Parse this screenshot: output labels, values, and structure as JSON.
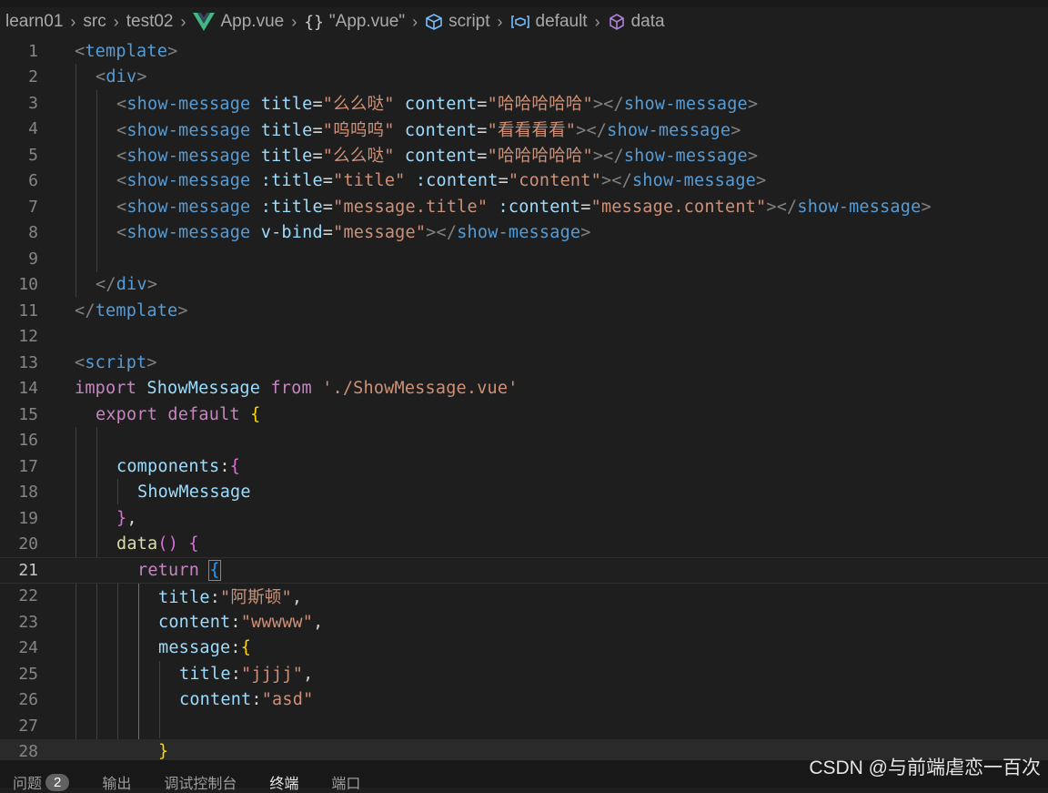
{
  "breadcrumb": {
    "items": [
      "learn01",
      "src",
      "test02",
      "App.vue",
      "\"App.vue\"",
      "script",
      "default",
      "data"
    ],
    "icons": [
      "vue-logo-icon",
      "braces-icon",
      "script-icon",
      "variable-icon",
      "cube-icon"
    ]
  },
  "editor": {
    "current_line": 21,
    "line_numbers": [
      "1",
      "2",
      "3",
      "4",
      "5",
      "6",
      "7",
      "8",
      "9",
      "10",
      "11",
      "12",
      "13",
      "14",
      "15",
      "16",
      "17",
      "18",
      "19",
      "20",
      "21",
      "22",
      "23",
      "24",
      "25",
      "26",
      "27",
      "28"
    ],
    "lines": {
      "l1": {
        "open": "<",
        "tag": "template",
        "close": ">"
      },
      "l2": {
        "open": "<",
        "tag": "div",
        "close": ">"
      },
      "l3": {
        "comp": "show-message",
        "a1": "title",
        "v1": "\"么么哒\"",
        "a2": "content",
        "v2": "\"哈哈哈哈哈\"",
        "end": "show-message"
      },
      "l4": {
        "comp": "show-message",
        "a1": "title",
        "v1": "\"呜呜呜\"",
        "a2": "content",
        "v2": "\"看看看看\"",
        "end": "show-message"
      },
      "l5": {
        "comp": "show-message",
        "a1": "title",
        "v1": "\"么么哒\"",
        "a2": "content",
        "v2": "\"哈哈哈哈哈\"",
        "end": "show-message"
      },
      "l6": {
        "comp": "show-message",
        "a1": ":title",
        "v1": "\"title\"",
        "a2": ":content",
        "v2": "\"content\"",
        "end": "show-message"
      },
      "l7": {
        "comp": "show-message",
        "a1": ":title",
        "v1": "\"message.title\"",
        "a2": ":content",
        "v2": "\"message.content\"",
        "end": "show-message"
      },
      "l8": {
        "comp": "show-message",
        "a1": "v-bind",
        "v1": "\"message\"",
        "end": "show-message"
      },
      "l10": {
        "tag": "div"
      },
      "l11": {
        "tag": "template"
      },
      "l13": {
        "tag": "script"
      },
      "l14": {
        "kw1": "import",
        "cls": "ShowMessage",
        "kw2": "from",
        "str": "'./ShowMessage.vue'"
      },
      "l15": {
        "kw1": "export",
        "kw2": "default",
        "brace": "{"
      },
      "l17": {
        "prop": "components",
        "brace": "{"
      },
      "l18": {
        "cls": "ShowMessage"
      },
      "l19": {
        "brace": "}",
        "comma": ","
      },
      "l20": {
        "fn": "data",
        "paren": "()",
        "brace": "{"
      },
      "l21": {
        "kw": "return",
        "brace": "{"
      },
      "l22": {
        "prop": "title",
        "str": "\"阿斯顿\"",
        "comma": ","
      },
      "l23": {
        "prop": "content",
        "str": "\"wwwww\"",
        "comma": ","
      },
      "l24": {
        "prop": "message",
        "brace": "{"
      },
      "l25": {
        "prop": "title",
        "str": "\"jjjj\"",
        "comma": ","
      },
      "l26": {
        "prop": "content",
        "str": "\"asd\""
      },
      "l28": {
        "brace": "}"
      }
    }
  },
  "panel": {
    "tabs": [
      "问题",
      "输出",
      "调试控制台",
      "终端",
      "端口"
    ],
    "problems_count": "2",
    "active_tab": "终端"
  },
  "watermark": "CSDN @与前端虐恋一百次"
}
